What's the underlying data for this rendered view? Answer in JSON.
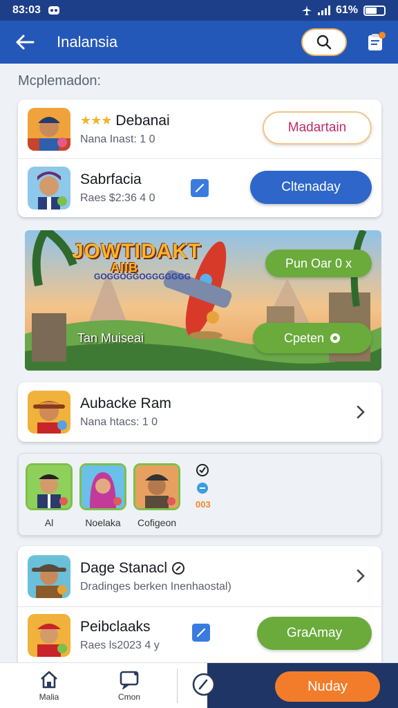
{
  "status_bar": {
    "time": "83:03",
    "battery": "61%",
    "battery_level": 0.61
  },
  "app_bar": {
    "title": "Inalansia"
  },
  "section": {
    "label": "Mcplemadon:"
  },
  "list1": [
    {
      "title": "Debanai",
      "subtitle": "Nana Inast: 1 0",
      "action": "Madartain"
    },
    {
      "title": "Sabrfacia",
      "subtitle": "Raes $2:36  4 0",
      "action": "Cltenaday"
    }
  ],
  "banner": {
    "title": "JOWTIDAKT",
    "title_line2": "AIIB",
    "subtitle": "GOGGOGGOGGGGGGG",
    "caption": "Tan Muiseai",
    "primary_button": "Pun Oar 0 x",
    "secondary_button": "Cpeten"
  },
  "single_item": {
    "title": "Aubacke Ram",
    "subtitle": "Nana htacs: 1 0"
  },
  "friends": {
    "items": [
      {
        "label": "Al"
      },
      {
        "label": "Noelaka"
      },
      {
        "label": "Cofigeon"
      }
    ],
    "counter": "003"
  },
  "list2": [
    {
      "title": "Dage Stanacl",
      "subtitle": "Dradinges berken Inenhaostal)"
    },
    {
      "title": "Peibclaaks",
      "subtitle": "Raes ls2023  4 y",
      "action": "GraAmay"
    }
  ],
  "bottom_nav": {
    "items": [
      {
        "label": "Malia"
      },
      {
        "label": "Cmon"
      }
    ],
    "cta": "Nuday"
  },
  "colors": {
    "primary": "#2458b8",
    "accent": "#f27c2a",
    "green": "#6aab3c"
  }
}
